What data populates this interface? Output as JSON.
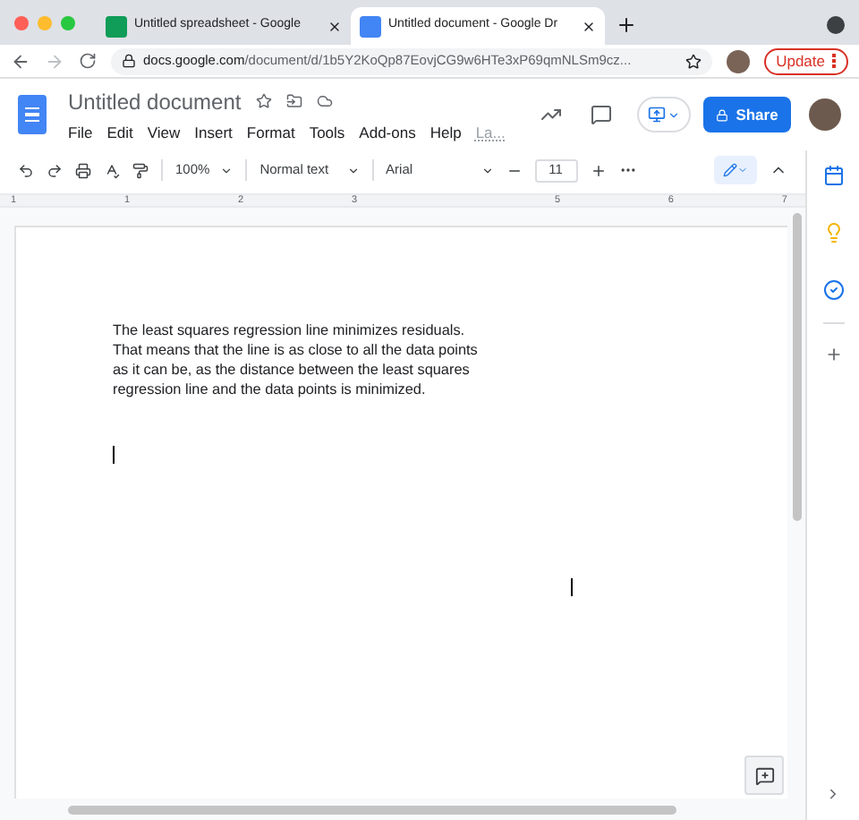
{
  "browser": {
    "tabs": [
      {
        "title": "Untitled spreadsheet - Google",
        "kind": "sheets",
        "selected": false
      },
      {
        "title": "Untitled document - Google Dr",
        "kind": "docs",
        "selected": true
      }
    ],
    "url_host": "docs.google.com",
    "url_path": "/document/d/1b5Y2KoQp87EovjCG9w6HTe3xP69qmNLSm9cz...",
    "update_button": "Update"
  },
  "docs": {
    "title": "Untitled document",
    "menu": [
      "File",
      "Edit",
      "View",
      "Insert",
      "Format",
      "Tools",
      "Add-ons",
      "Help"
    ],
    "last_edit": "La...",
    "share_button": "Share"
  },
  "toolbar": {
    "zoom": "100%",
    "style": "Normal text",
    "font": "Arial",
    "font_size": "11"
  },
  "ruler": [
    "1",
    "1",
    "2",
    "3",
    "5",
    "6",
    "7"
  ],
  "document": {
    "paragraph": "The least squares regression line minimizes residuals. That means that the line is as close to all the data points as it can be, as the distance between the least squares regression line and the data points is minimized."
  }
}
